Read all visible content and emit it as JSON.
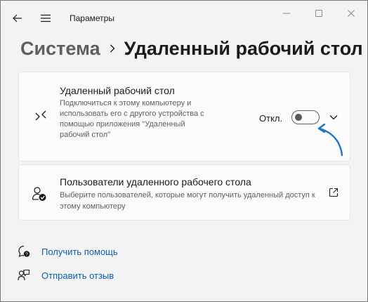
{
  "window": {
    "title": "Параметры"
  },
  "breadcrumb": {
    "parent": "Система",
    "current": "Удаленный рабочий стол"
  },
  "rdp_card": {
    "title": "Удаленный рабочий стол",
    "description": "Подключиться к этому компьютеру и использовать его с другого устройства с помощью приложения \"Удаленный рабочий стол\"",
    "toggle_state_label": "Откл.",
    "toggle_on": false,
    "icon": "remote-desktop-icon"
  },
  "users_card": {
    "title": "Пользователи удаленного рабочего стола",
    "description": "Выберите пользователей, которые могут получить удаленный доступ к этому компьютеру",
    "icon": "users-check-icon",
    "link_icon": "open-external-icon"
  },
  "links": {
    "help": "Получить помощь",
    "feedback": "Отправить отзыв"
  },
  "colors": {
    "accent_link": "#0a5fb4",
    "annotation_arrow": "#1e73c8",
    "background": "#f3f3f3",
    "card": "#fbfbfb"
  }
}
